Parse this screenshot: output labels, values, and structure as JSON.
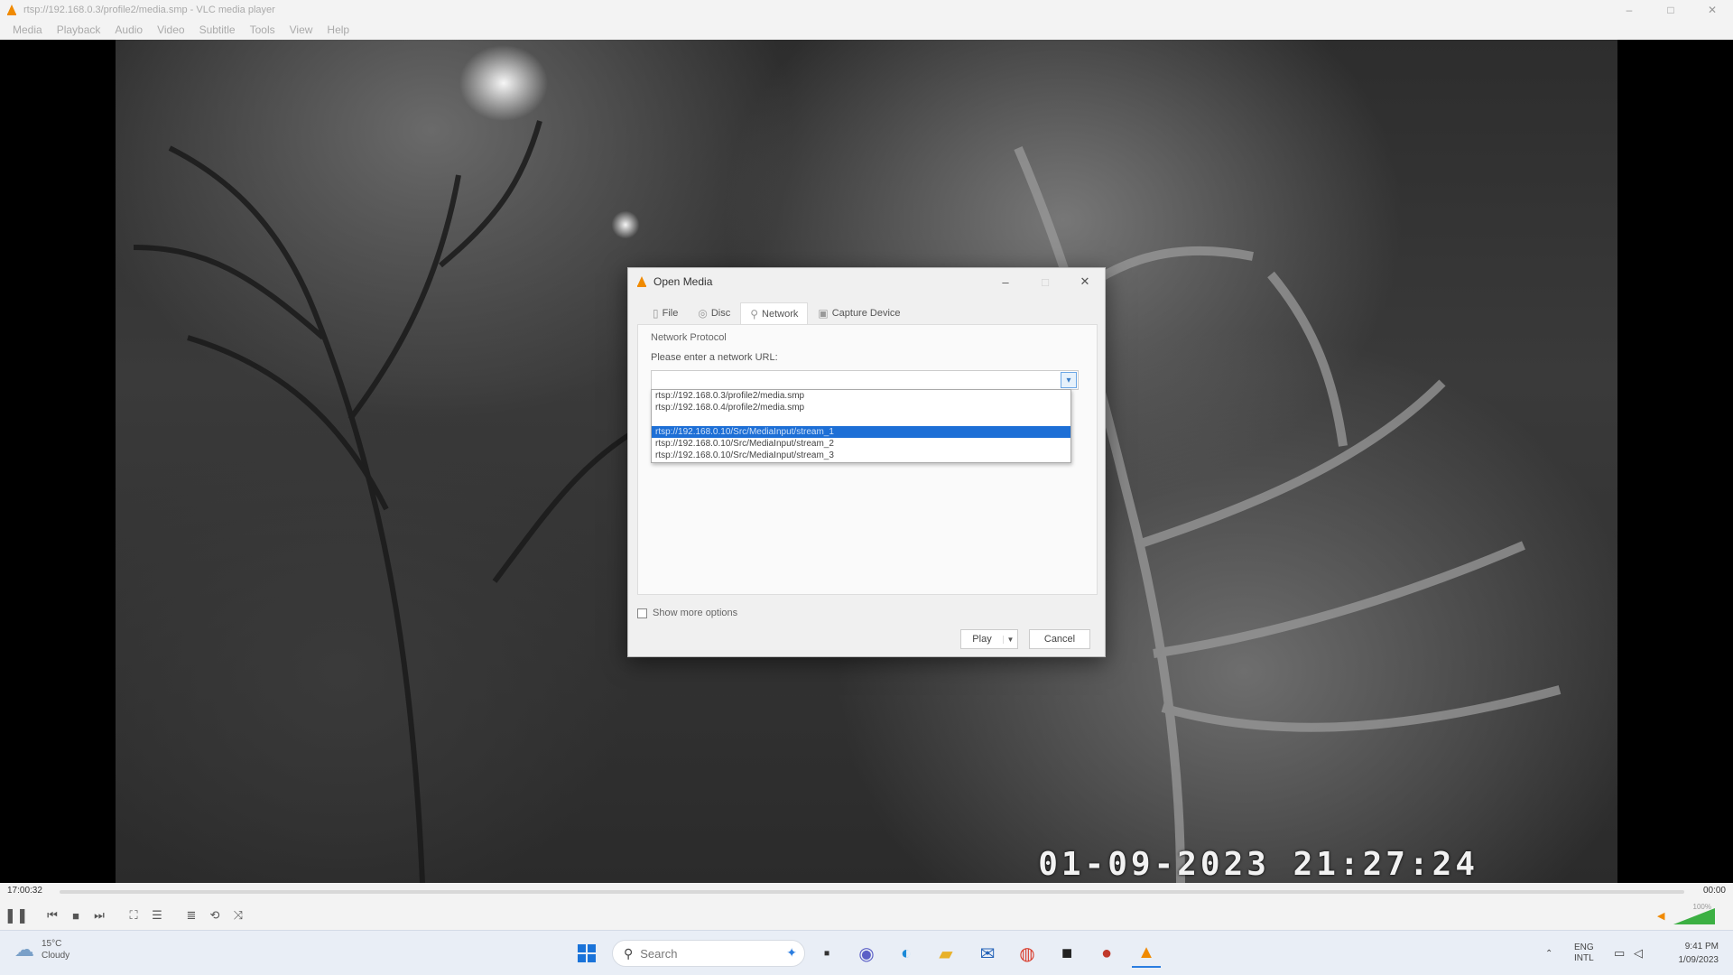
{
  "window": {
    "title": "rtsp://192.168.0.3/profile2/media.smp - VLC media player",
    "controls": {
      "minimize": "–",
      "maximize": "□",
      "close": "✕"
    }
  },
  "menu": [
    "Media",
    "Playback",
    "Audio",
    "Video",
    "Subtitle",
    "Tools",
    "View",
    "Help"
  ],
  "video": {
    "osd_timestamp": "01-09-2023 21:27:24"
  },
  "dialog": {
    "title": "Open Media",
    "tabs": [
      {
        "label": "File",
        "icon": "file-icon"
      },
      {
        "label": "Disc",
        "icon": "disc-icon"
      },
      {
        "label": "Network",
        "icon": "network-icon",
        "active": true
      },
      {
        "label": "Capture Device",
        "icon": "capture-device-icon"
      }
    ],
    "group_title": "Network Protocol",
    "prompt": "Please enter a network URL:",
    "url_value": "",
    "history": [
      "rtsp://192.168.0.3/profile2/media.smp",
      "rtsp://192.168.0.4/profile2/media.smp",
      "rtsp://192.168.0.10/Src/MediaInput/stream_1",
      "rtsp://192.168.0.10/Src/MediaInput/stream_2",
      "rtsp://192.168.0.10/Src/MediaInput/stream_3"
    ],
    "selected_index": 2,
    "show_more_label": "Show more options",
    "play_label": "Play",
    "cancel_label": "Cancel"
  },
  "player": {
    "elapsed": "17:00:32",
    "remaining": "00:00",
    "volume_percent": "100%"
  },
  "taskbar": {
    "weather_temp": "15°C",
    "weather_cond": "Cloudy",
    "search_placeholder": "Search",
    "lang_top": "ENG",
    "lang_bottom": "INTL",
    "time": "9:41 PM",
    "date": "1/09/2023"
  },
  "colors": {
    "selection": "#1d6fd6",
    "vlc_orange": "#f08a00",
    "taskbar": "#e9eef6"
  }
}
